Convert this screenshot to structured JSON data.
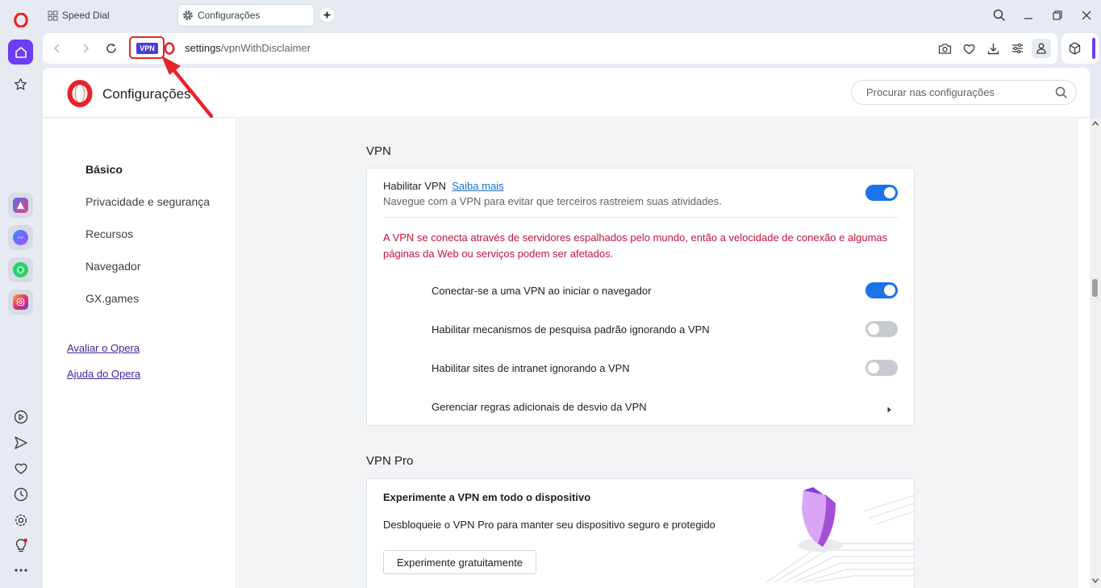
{
  "browser": {
    "tabs": [
      {
        "label": "Speed Dial",
        "icon": "grid-icon"
      },
      {
        "label": "Configurações",
        "icon": "gear-icon",
        "active": true
      }
    ],
    "address": {
      "host": "settings",
      "path": "/vpnWithDisclaimer"
    },
    "vpn_badge": "VPN",
    "accent": "#6d3cf5"
  },
  "settings": {
    "title": "Configurações",
    "search_placeholder": "Procurar nas configurações",
    "sidebar": {
      "items": [
        "Básico",
        "Privacidade e segurança",
        "Recursos",
        "Navegador",
        "GX.games"
      ],
      "links": [
        "Avaliar o Opera",
        "Ajuda do Opera"
      ]
    },
    "vpn": {
      "section_title": "VPN",
      "enable_label": "Habilitar VPN",
      "learn_more": "Saiba mais",
      "enable_desc": "Navegue com a VPN para evitar que terceiros rastreiem suas atividades.",
      "enable_on": true,
      "warning": "A VPN se conecta através de servidores espalhados pelo mundo, então a velocidade de conexão e algumas páginas da Web ou serviços podem ser afetados.",
      "options": [
        {
          "label": "Conectar-se a uma VPN ao iniciar o navegador",
          "on": true
        },
        {
          "label": "Habilitar mecanismos de pesquisa padrão ignorando a VPN",
          "on": false
        },
        {
          "label": "Habilitar sites de intranet ignorando a VPN",
          "on": false
        }
      ],
      "manage_rules": "Gerenciar regras adicionais de desvio da VPN"
    },
    "vpn_pro": {
      "section_title": "VPN Pro",
      "heading": "Experimente a VPN em todo o dispositivo",
      "desc": "Desbloqueie o VPN Pro para manter seu dispositivo seguro e protegido",
      "button": "Experimente gratuitamente"
    }
  },
  "colors": {
    "toggle_on": "#1a73e8",
    "warning": "#c5133d",
    "opera_red": "#e8232a",
    "annotation": "#e8232a"
  }
}
